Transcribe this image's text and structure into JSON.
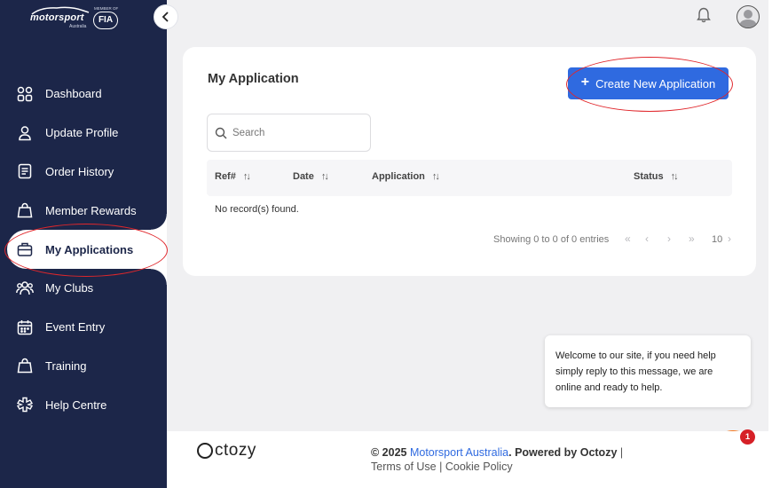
{
  "brand": {
    "logo_text": "motorsport",
    "logo_sub": "Australia",
    "member_of": "MEMBER OF",
    "fia": "FIA"
  },
  "sidebar": {
    "items": [
      {
        "label": "Dashboard",
        "icon": "grid-icon"
      },
      {
        "label": "Update Profile",
        "icon": "user-icon"
      },
      {
        "label": "Order History",
        "icon": "receipt-icon"
      },
      {
        "label": "Member Rewards",
        "icon": "shopping-bag-icon"
      },
      {
        "label": "My Applications",
        "icon": "briefcase-icon",
        "active": true
      },
      {
        "label": "My Clubs",
        "icon": "group-icon"
      },
      {
        "label": "Event Entry",
        "icon": "calendar-icon"
      },
      {
        "label": "Training",
        "icon": "bag-icon"
      },
      {
        "label": "Help Centre",
        "icon": "medical-icon"
      }
    ]
  },
  "card": {
    "title": "My Application",
    "create_button": "Create New Application",
    "search_placeholder": "Search",
    "columns": [
      "Ref#",
      "Date",
      "Application",
      "Status"
    ],
    "empty_message": "No record(s) found.",
    "showing": "Showing 0 to 0 of 0 entries",
    "page_size": "10"
  },
  "chat": {
    "message": "Welcome to our site, if you need help simply reply to this message, we are online and ready to help.",
    "badge": "1"
  },
  "footer": {
    "logo": "ctozy",
    "copyright": "© 2025 ",
    "org_link": "Motorsport Australia",
    "powered": ". Powered by Octozy",
    "terms": "Terms of Use",
    "cookie": "Cookie Policy",
    "separator": " | "
  },
  "colors": {
    "sidebar": "#1c2649",
    "accent": "#2f6ae0",
    "chat": "#f4781f",
    "annotation": "#e0262b"
  }
}
